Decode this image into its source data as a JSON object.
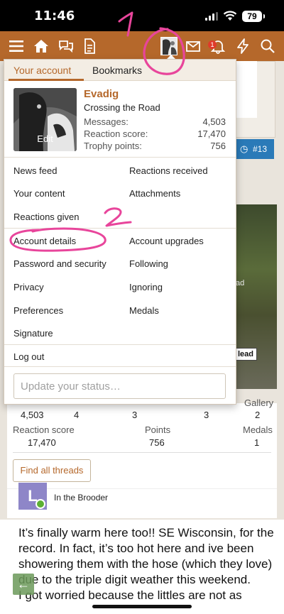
{
  "status_bar": {
    "time": "11:46",
    "battery": "79"
  },
  "navbar": {
    "notification_count": "1"
  },
  "menu": {
    "tabs": [
      {
        "label": "Your account"
      },
      {
        "label": "Bookmarks"
      }
    ],
    "profile": {
      "edit_label": "Edit",
      "username": "Evadig",
      "user_title": "Crossing the Road",
      "stats": [
        {
          "label": "Messages:",
          "value": "4,503"
        },
        {
          "label": "Reaction score:",
          "value": "17,470"
        },
        {
          "label": "Trophy points:",
          "value": "756"
        }
      ]
    },
    "links_left": [
      "News feed",
      "Your content",
      "Reactions given",
      "Account details",
      "Password and security",
      "Privacy",
      "Preferences",
      "Signature"
    ],
    "links_right": [
      "Reactions received",
      "Attachments",
      "Account upgrades",
      "Following",
      "Ignoring",
      "Medals"
    ],
    "logout": "Log out",
    "status_placeholder": "Update your status…"
  },
  "background": {
    "post_number": "#13",
    "photo_label": "lead",
    "photo_partial": "ad",
    "stats_row1": {
      "gallery_label": "Gallery",
      "values": [
        "4,503",
        "4",
        "3",
        "3",
        "2"
      ]
    },
    "stats_row2": {
      "labels": [
        "Reaction score",
        "Points",
        "Medals"
      ],
      "values": [
        "17,470",
        "756",
        "1"
      ]
    },
    "find_threads": "Find all threads",
    "avatar_letter": "L",
    "user_title": "In the Brooder",
    "post_text": "It’s finally warm here too!! SE Wisconsin, for the record. In fact, it’s too hot here and ive been showering them with the hose (which they love) due to the triple digit weather this weekend.\nI got worried because the littles are not as"
  },
  "annotations": {
    "one": "1",
    "two": "2"
  },
  "colors": {
    "brand": "#b5682b",
    "accent_blue": "#2a7ab8",
    "annotation_pink": "#e8459b"
  }
}
